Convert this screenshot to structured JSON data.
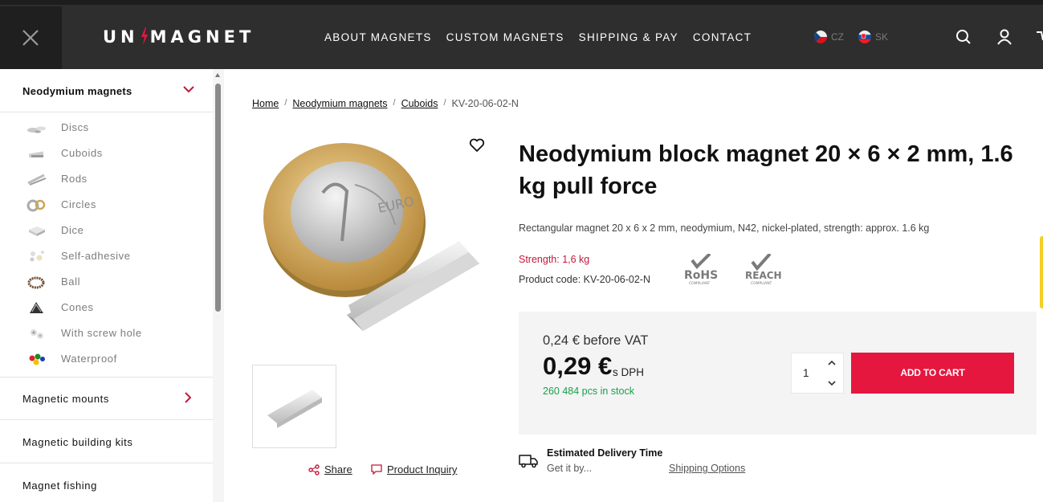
{
  "header": {
    "logo": "UNIMAGNET",
    "nav": [
      "ABOUT MAGNETS",
      "CUSTOM MAGNETS",
      "SHIPPING & PAY",
      "CONTACT"
    ],
    "languages": [
      {
        "code": "CZ",
        "flag": "czech-flag-icon"
      },
      {
        "code": "SK",
        "flag": "slovak-flag-icon"
      }
    ],
    "icons": [
      "close-icon",
      "search-icon",
      "user-icon",
      "cart-icon"
    ]
  },
  "sidebar": {
    "section_title": "Neodymium magnets",
    "subitems": [
      "Discs",
      "Cuboids",
      "Rods",
      "Circles",
      "Dice",
      "Self-adhesive",
      "Ball",
      "Cones",
      "With screw hole",
      "Waterproof"
    ],
    "categories": [
      "Magnetic mounts",
      "Magnetic building kits",
      "Magnet fishing"
    ]
  },
  "breadcrumb": {
    "items": [
      "Home",
      "Neodymium magnets",
      "Cuboids"
    ],
    "separator": "/",
    "current": "KV-20-06-02-N"
  },
  "product": {
    "title": "Neodymium block magnet 20 × 6 × 2 mm, 1.6 kg pull force",
    "description": "Rectangular magnet 20 x 6 x 2 mm, neodymium, N42, nickel-plated, strength: approx. 1.6 kg",
    "strength": "Strength: 1,6 kg",
    "product_code": "Product code: KV-20-06-02-N",
    "badges": [
      {
        "name": "RoHS",
        "sub": "COMPLIANT"
      },
      {
        "name": "REACH",
        "sub": "COMPLIANT"
      }
    ],
    "share_label": "Share",
    "inquiry_label": "Product Inquiry"
  },
  "pricing": {
    "price_before_vat": "0,24 € before VAT",
    "price": "0,29 €",
    "vat_label": "s DPH",
    "stock": "260 484 pcs in stock",
    "quantity": "1",
    "add_to_cart": "ADD TO CART"
  },
  "delivery": {
    "title": "Estimated Delivery Time",
    "subtitle": "Get it by...",
    "shipping_options": "Shipping Options"
  },
  "colors": {
    "header_bg": "#2e2e2e",
    "accent": "#e5173f",
    "strength_red": "#c2183a",
    "stock_green": "#1a9e4a",
    "price_box": "#f4f4f4"
  }
}
